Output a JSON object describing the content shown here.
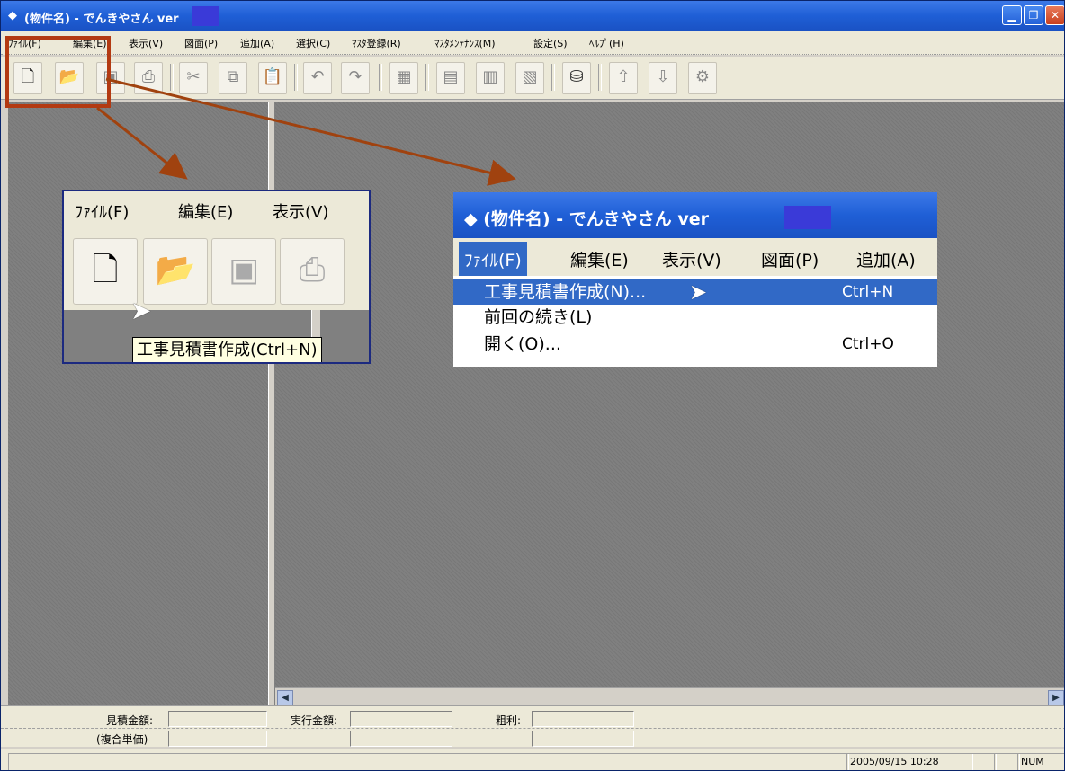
{
  "window": {
    "icon": "app-diamond-icon",
    "title": "(物件名) - でんきやさん ver",
    "controls": [
      "minimize-icon",
      "maximize-icon",
      "close-icon"
    ]
  },
  "menubar": [
    "ﾌｧｲﾙ(F)",
    "編集(E)",
    "表示(V)",
    "図面(P)",
    "追加(A)",
    "選択(C)",
    "ﾏｽﾀ登録(R)",
    "ﾏｽﾀﾒﾝﾃﾅﾝｽ(M)",
    "設定(S)",
    "ﾍﾙﾌﾟ(H)"
  ],
  "toolbar": {
    "buttons": [
      "new-document-icon",
      "open-folder-icon",
      "save-disk-icon",
      "print-icon",
      "cut-icon",
      "copy-icon",
      "paste-icon",
      "undo-icon",
      "redo-icon",
      "drawing-icon",
      "table1-icon",
      "table2-icon",
      "table3-icon",
      "database-icon",
      "up-arrow-icon",
      "down-arrow-icon",
      "tool-icon"
    ]
  },
  "summary": {
    "estimate_label": "見積金額:",
    "execution_label": "実行金額:",
    "gross_profit_label": "粗利:",
    "composite_label": "(複合単価)"
  },
  "status": {
    "datetime": "2005/09/15 10:28",
    "num": "NUM"
  },
  "callout_toolbar": {
    "menu": [
      "ﾌｧｲﾙ(F)",
      "編集(E)",
      "表示(V)"
    ],
    "tooltip": "工事見積書作成(Ctrl+N)"
  },
  "callout_menu": {
    "title": "(物件名) - でんきやさん ver",
    "menu": [
      "ﾌｧｲﾙ(F)",
      "編集(E)",
      "表示(V)",
      "図面(P)",
      "追加(A)"
    ],
    "items": [
      {
        "label": "工事見積書作成(N)...",
        "shortcut": "Ctrl+N",
        "selected": true
      },
      {
        "label": "前回の続き(L)",
        "shortcut": "",
        "selected": false
      },
      {
        "label": "開く(O)...",
        "shortcut": "Ctrl+O",
        "selected": false
      }
    ]
  },
  "colors": {
    "titlebar": "#1f5fd6",
    "highlight": "#b33a12",
    "selection": "#3169c6",
    "workspace": "#808080"
  }
}
